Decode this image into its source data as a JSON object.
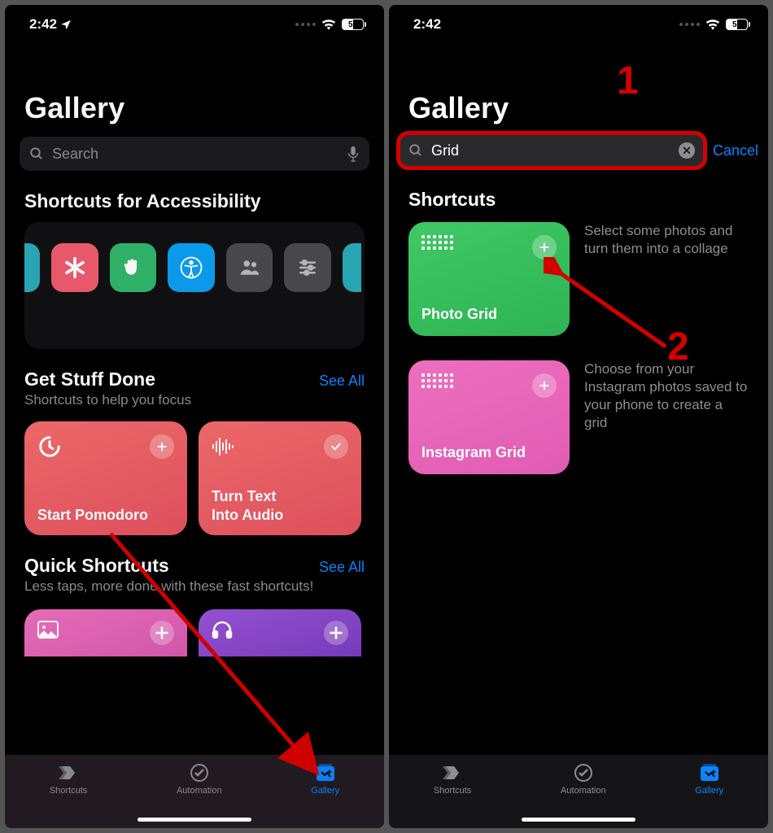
{
  "status": {
    "time": "2:42",
    "battery": "53"
  },
  "left": {
    "title": "Gallery",
    "search_placeholder": "Search",
    "sec_accessibility": "Shortcuts for Accessibility",
    "sec_getstuff": {
      "title": "Get Stuff Done",
      "sub": "Shortcuts to help you focus",
      "see_all": "See All"
    },
    "card_pomodoro": "Start Pomodoro",
    "card_tts1": "Turn Text",
    "card_tts2": "Into Audio",
    "sec_quick": {
      "title": "Quick Shortcuts",
      "sub": "Less taps, more done with these fast shortcuts!",
      "see_all": "See All"
    }
  },
  "right": {
    "title": "Gallery",
    "search_value": "Grid",
    "cancel": "Cancel",
    "sec_title": "Shortcuts",
    "photo_grid": {
      "title": "Photo Grid",
      "desc": "Select some photos and turn them into a collage"
    },
    "insta_grid": {
      "title": "Instagram Grid",
      "desc": "Choose from your Instagram photos saved to your phone to create a grid"
    }
  },
  "tabs": {
    "shortcuts": "Shortcuts",
    "automation": "Automation",
    "gallery": "Gallery"
  },
  "annotations": {
    "one": "1",
    "two": "2"
  }
}
